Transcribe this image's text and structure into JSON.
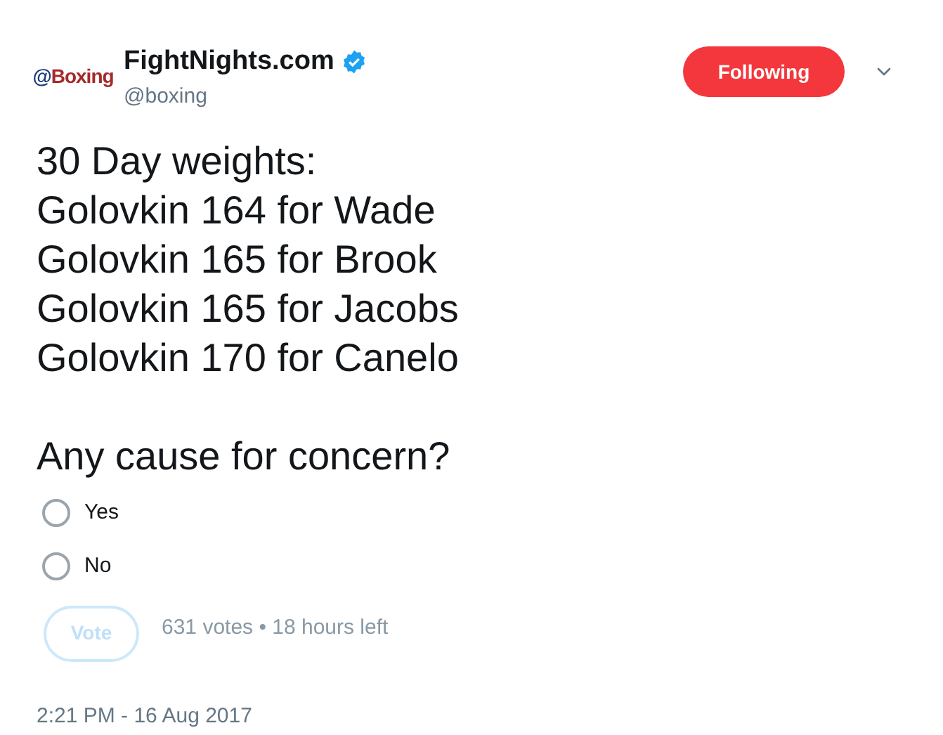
{
  "author": {
    "avatar_text": "@Boxing",
    "name": "FightNights.com",
    "verified": true,
    "handle": "@boxing"
  },
  "follow_button": {
    "label": "Following",
    "following": true
  },
  "tweet_text": "30 Day weights:\nGolovkin 164 for Wade\nGolovkin 165 for Brook\nGolovkin 165 for Jacobs\nGolovkin 170 for Canelo\n\nAny cause for concern?",
  "poll": {
    "options": [
      {
        "label": "Yes",
        "selected": false
      },
      {
        "label": "No",
        "selected": false
      }
    ],
    "vote_button": {
      "label": "Vote",
      "disabled": true
    },
    "summary": "631 votes • 18 hours left"
  },
  "timestamp": "2:21 PM - 16 Aug 2017"
}
